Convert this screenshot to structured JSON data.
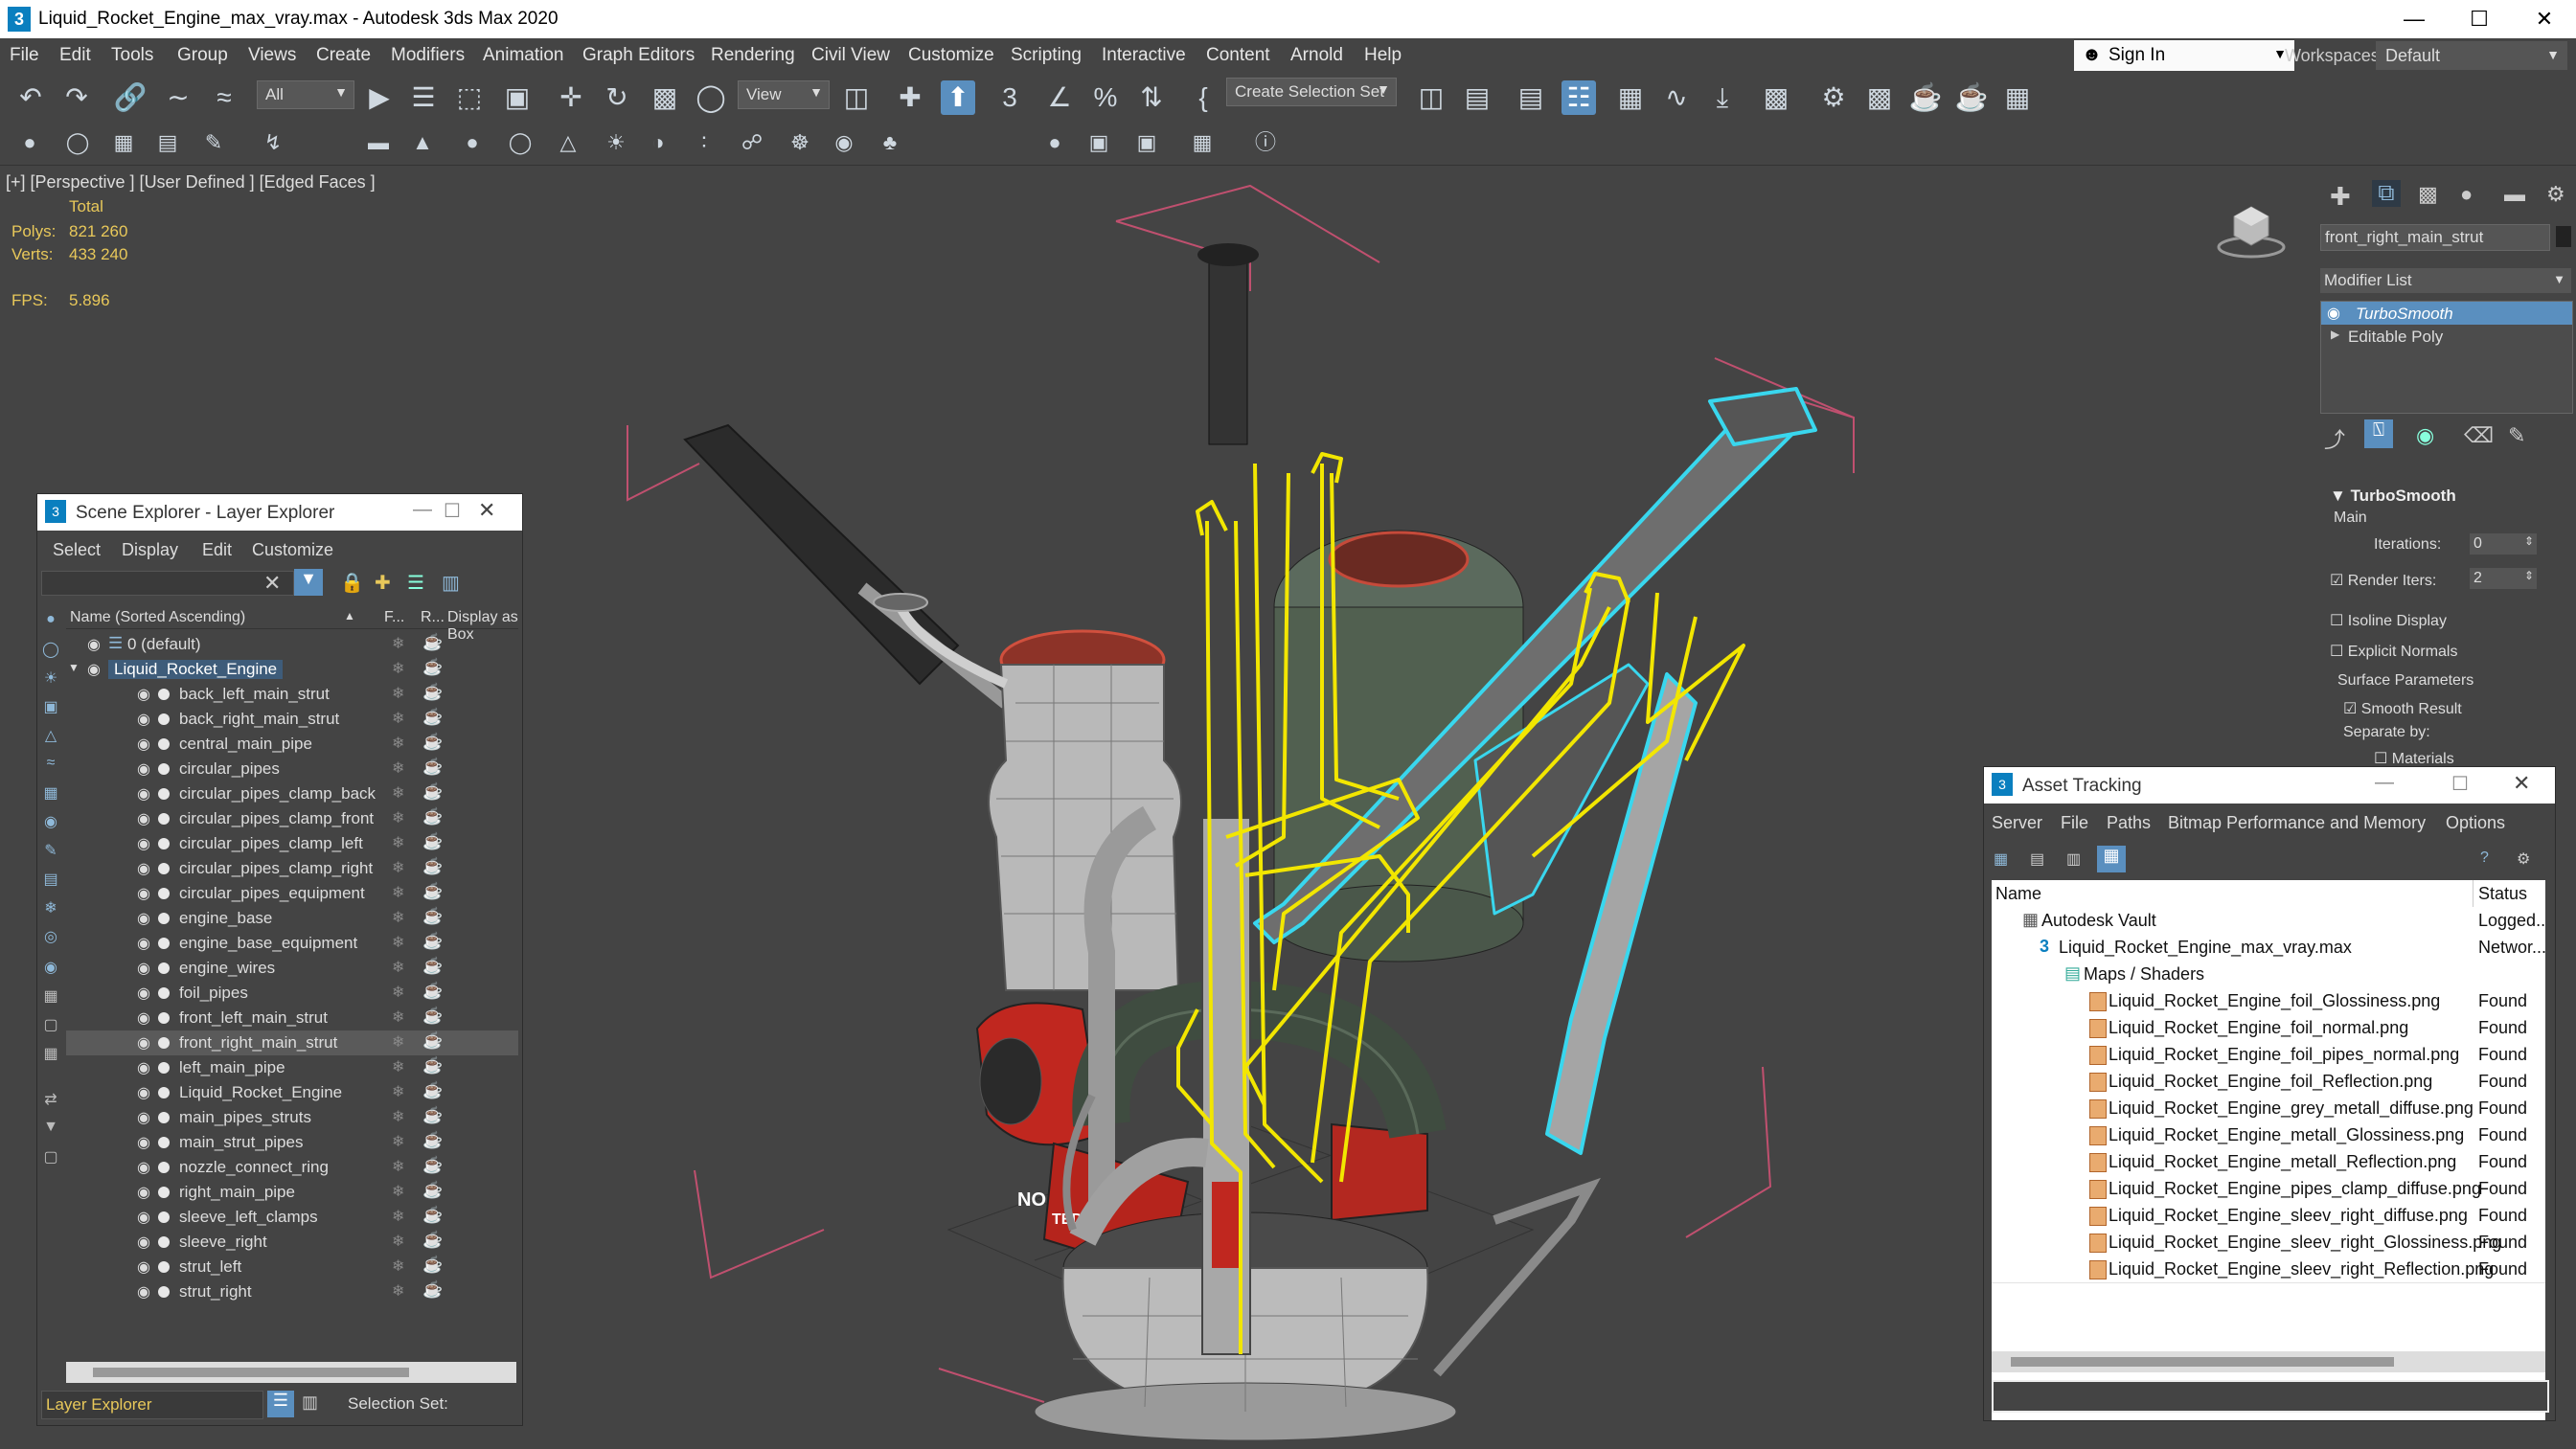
{
  "window": {
    "title": "Liquid_Rocket_Engine_max_vray.max - Autodesk 3ds Max 2020",
    "app_icon": "3"
  },
  "menu": [
    "File",
    "Edit",
    "Tools",
    "Group",
    "Views",
    "Create",
    "Modifiers",
    "Animation",
    "Graph Editors",
    "Rendering",
    "Civil View",
    "Customize",
    "Scripting",
    "Interactive",
    "Content",
    "Arnold",
    "Help"
  ],
  "account": {
    "sign_in": "Sign In",
    "workspaces_label": "Workspaces:",
    "workspaces_value": "Default"
  },
  "toolbar": {
    "filter_value": "All",
    "ref_coord": "View",
    "selection_set": "Create Selection Set"
  },
  "viewport": {
    "label": "[+] [Perspective ]  [User Defined ]  [Edged Faces ]",
    "stats_header": "Total",
    "polys_label": "Polys:",
    "polys_value": "821 260",
    "verts_label": "Verts:",
    "verts_value": "433 240",
    "fps_label": "FPS:",
    "fps_value": "5.896",
    "decal_left": "NO",
    "decal_right": "TED"
  },
  "scene_explorer": {
    "title": "Scene Explorer - Layer Explorer",
    "menu": [
      "Select",
      "Display",
      "Edit",
      "Customize"
    ],
    "columns": {
      "name": "Name (Sorted Ascending)",
      "f": "F...",
      "r": "R...",
      "box": "Display as Box"
    },
    "default_layer": "0 (default)",
    "layer": "Liquid_Rocket_Engine",
    "objects": [
      "back_left_main_strut",
      "back_right_main_strut",
      "central_main_pipe",
      "circular_pipes",
      "circular_pipes_clamp_back",
      "circular_pipes_clamp_front",
      "circular_pipes_clamp_left",
      "circular_pipes_clamp_right",
      "circular_pipes_equipment",
      "engine_base",
      "engine_base_equipment",
      "engine_wires",
      "foil_pipes",
      "front_left_main_strut",
      "front_right_main_strut",
      "left_main_pipe",
      "Liquid_Rocket_Engine",
      "main_pipes_struts",
      "main_strut_pipes",
      "nozzle_connect_ring",
      "right_main_pipe",
      "sleeve_left_clamps",
      "sleeve_right",
      "strut_left",
      "strut_right"
    ],
    "selected": "front_right_main_strut",
    "footer_explorer": "Layer Explorer",
    "footer_selset": "Selection Set:"
  },
  "command_panel": {
    "object_name": "front_right_main_strut",
    "modifier_list": "Modifier List",
    "stack": [
      "TurboSmooth",
      "Editable Poly"
    ],
    "rollout": "TurboSmooth",
    "main": "Main",
    "iterations_label": "Iterations:",
    "iterations_value": "0",
    "render_iters_label": "Render Iters:",
    "render_iters_value": "2",
    "isoline": "Isoline Display",
    "explicit": "Explicit Normals",
    "surface": "Surface Parameters",
    "smooth": "Smooth Result",
    "separate": "Separate by:",
    "materials": "Materials"
  },
  "asset_tracking": {
    "title": "Asset Tracking",
    "menu": [
      "Server",
      "File",
      "Paths",
      "Bitmap Performance and Memory",
      "Options"
    ],
    "col_name": "Name",
    "col_status": "Status",
    "vault": {
      "name": "Autodesk Vault",
      "status": "Logged..."
    },
    "file": {
      "name": "Liquid_Rocket_Engine_max_vray.max",
      "status": "Networ..."
    },
    "maps_folder": "Maps / Shaders",
    "maps": [
      {
        "name": "Liquid_Rocket_Engine_foil_Glossiness.png",
        "status": "Found"
      },
      {
        "name": "Liquid_Rocket_Engine_foil_normal.png",
        "status": "Found"
      },
      {
        "name": "Liquid_Rocket_Engine_foil_pipes_normal.png",
        "status": "Found"
      },
      {
        "name": "Liquid_Rocket_Engine_foil_Reflection.png",
        "status": "Found"
      },
      {
        "name": "Liquid_Rocket_Engine_grey_metall_diffuse.png",
        "status": "Found"
      },
      {
        "name": "Liquid_Rocket_Engine_metall_Glossiness.png",
        "status": "Found"
      },
      {
        "name": "Liquid_Rocket_Engine_metall_Reflection.png",
        "status": "Found"
      },
      {
        "name": "Liquid_Rocket_Engine_pipes_clamp_diffuse.png",
        "status": "Found"
      },
      {
        "name": "Liquid_Rocket_Engine_sleev_right_diffuse.png",
        "status": "Found"
      },
      {
        "name": "Liquid_Rocket_Engine_sleev_right_Glossiness.png",
        "status": "Found"
      },
      {
        "name": "Liquid_Rocket_Engine_sleev_right_Reflection.png",
        "status": "Found"
      }
    ]
  },
  "colors": {
    "selection_yellow": "#f2e600",
    "selection_cyan": "#39d7ee",
    "accent_blue": "#5a8fbf",
    "stats_yellow": "#e8c85a"
  },
  "icons": [
    "undo-icon",
    "redo-icon",
    "link-icon",
    "unlink-icon",
    "bind-space-warp-icon",
    "select-icon",
    "move-icon",
    "rotate-icon",
    "scale-icon",
    "snap-icon",
    "angle-snap-icon",
    "percent-snap-icon",
    "mirror-icon",
    "align-icon",
    "render-icon",
    "viewcube-icon",
    "eye-icon",
    "freeze-icon",
    "teapot-icon"
  ]
}
